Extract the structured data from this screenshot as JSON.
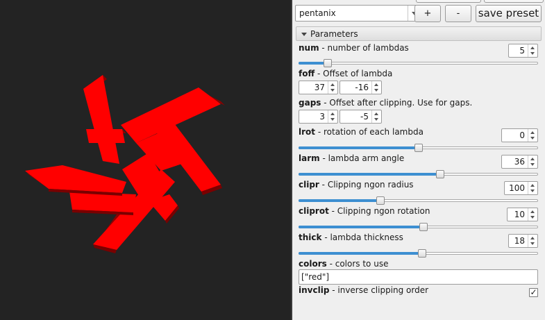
{
  "colors": {
    "shape_face": "#ff0000",
    "shape_side": "#8e0000",
    "viewport_bg": "#232323",
    "panel_bg": "#efefef",
    "slider_fill": "#3d8fd1"
  },
  "preset": {
    "selected": "pentanix",
    "add_label": "+",
    "remove_label": "-",
    "save_label": "save preset"
  },
  "parameters": {
    "header": "Parameters",
    "num": {
      "name": "num",
      "desc": " - number of lambdas",
      "value": "5",
      "fraction": 0.107
    },
    "foff": {
      "name": "foff",
      "desc": " - Offset of lambda",
      "x": "37",
      "y": "-16"
    },
    "gaps": {
      "name": "gaps",
      "desc": " - Offset after clipping. Use for gaps.",
      "x": "3",
      "y": "-5"
    },
    "lrot": {
      "name": "lrot",
      "desc": " - rotation of each lambda",
      "value": "0",
      "fraction": 0.5
    },
    "larm": {
      "name": "larm",
      "desc": " - lambda arm angle",
      "value": "36",
      "fraction": 0.594
    },
    "clipr": {
      "name": "clipr",
      "desc": " - Clipping ngon radius",
      "value": "100",
      "fraction": 0.336
    },
    "cliprot": {
      "name": "cliprot",
      "desc": " - Clipping ngon rotation",
      "value": "10",
      "fraction": 0.524
    },
    "thick": {
      "name": "thick",
      "desc": " - lambda thickness",
      "value": "18",
      "fraction": 0.517
    },
    "colors_param": {
      "name": "colors",
      "desc": " - colors to use",
      "value": "[\"red\"]"
    },
    "invclip": {
      "name": "invclip",
      "desc": " - inverse clipping order",
      "checked": "✓"
    }
  }
}
